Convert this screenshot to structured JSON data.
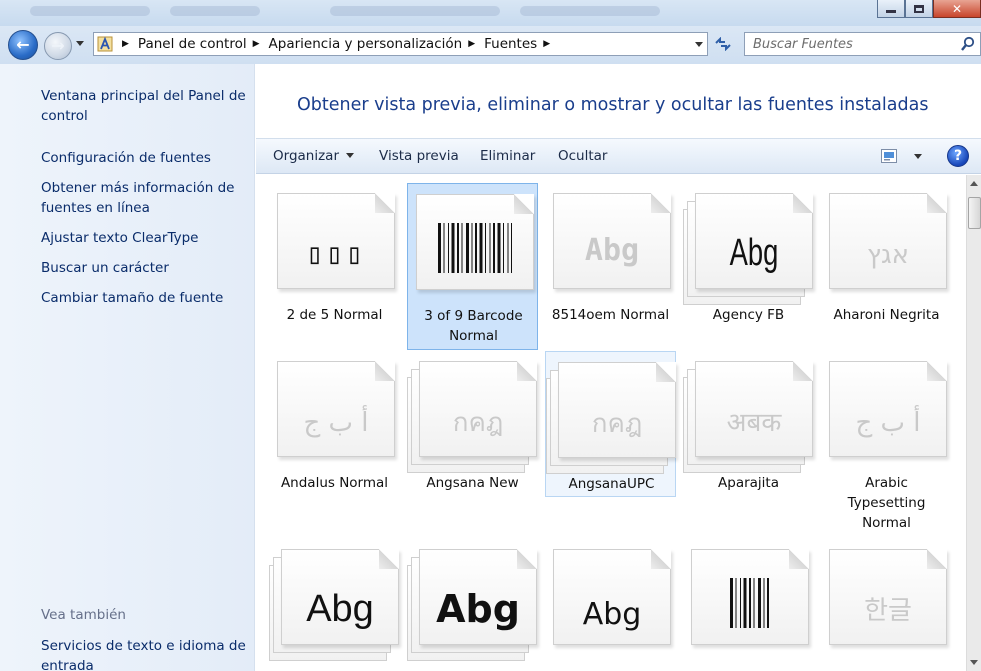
{
  "window": {
    "controls": {
      "minimize_icon": "minimize-icon",
      "maximize_icon": "maximize-icon",
      "close_glyph": "✕"
    }
  },
  "nav": {
    "back_glyph": "←",
    "forward_glyph": "→",
    "breadcrumbs": [
      "Panel de control",
      "Apariencia y personalización",
      "Fuentes"
    ],
    "search_placeholder": "Buscar Fuentes"
  },
  "sidebar": {
    "links": [
      "Ventana principal del Panel de control",
      "Configuración de fuentes",
      "Obtener más información de fuentes en línea",
      "Ajustar texto ClearType",
      "Buscar un carácter",
      "Cambiar tamaño de fuente"
    ],
    "see_also_heading": "Vea también",
    "see_also_links": [
      "Servicios de texto e idioma de entrada"
    ]
  },
  "main": {
    "title": "Obtener vista previa, eliminar o mostrar y ocultar las fuentes instaladas",
    "commands": {
      "organize": "Organizar",
      "preview": "Vista previa",
      "delete": "Eliminar",
      "hide": "Ocultar",
      "help": "?"
    }
  },
  "fonts": [
    {
      "name": "2 de 5 Normal",
      "preview": "▯▯▯",
      "state": "normal",
      "stack": false,
      "faded": false
    },
    {
      "name": "3 of 9 Barcode Normal",
      "preview": "barcode",
      "state": "selected",
      "stack": false,
      "faded": false
    },
    {
      "name": "8514oem Normal",
      "preview": "Abg",
      "state": "normal",
      "stack": false,
      "faded": true
    },
    {
      "name": "Agency FB",
      "preview": "Abg",
      "state": "normal",
      "stack": true,
      "faded": false
    },
    {
      "name": "Aharoni Negrita",
      "preview": "אגץ",
      "state": "normal",
      "stack": false,
      "faded": true
    },
    {
      "name": "Andalus Normal",
      "preview": "أ ب ج",
      "state": "normal",
      "stack": false,
      "faded": true
    },
    {
      "name": "Angsana New",
      "preview": "กคฎ",
      "state": "normal",
      "stack": true,
      "faded": true
    },
    {
      "name": "AngsanaUPC",
      "preview": "กคฎ",
      "state": "hover",
      "stack": true,
      "faded": true
    },
    {
      "name": "Aparajita",
      "preview": "अबक",
      "state": "normal",
      "stack": true,
      "faded": true
    },
    {
      "name": "Arabic Typesetting Normal",
      "preview": "أ ب ج",
      "state": "normal",
      "stack": false,
      "faded": true
    },
    {
      "name": "",
      "preview": "Abg",
      "state": "normal",
      "stack": true,
      "faded": false
    },
    {
      "name": "",
      "preview": "Abg",
      "state": "normal",
      "stack": true,
      "faded": false
    },
    {
      "name": "",
      "preview": "Abg",
      "state": "normal",
      "stack": false,
      "faded": false
    },
    {
      "name": "",
      "preview": "barcode",
      "state": "normal",
      "stack": false,
      "faded": false
    },
    {
      "name": "",
      "preview": "한글",
      "state": "normal",
      "stack": false,
      "faded": true
    }
  ],
  "colors": {
    "link": "#0a2c6a",
    "title": "#1a3e8c",
    "selection": "#cde3fb"
  }
}
